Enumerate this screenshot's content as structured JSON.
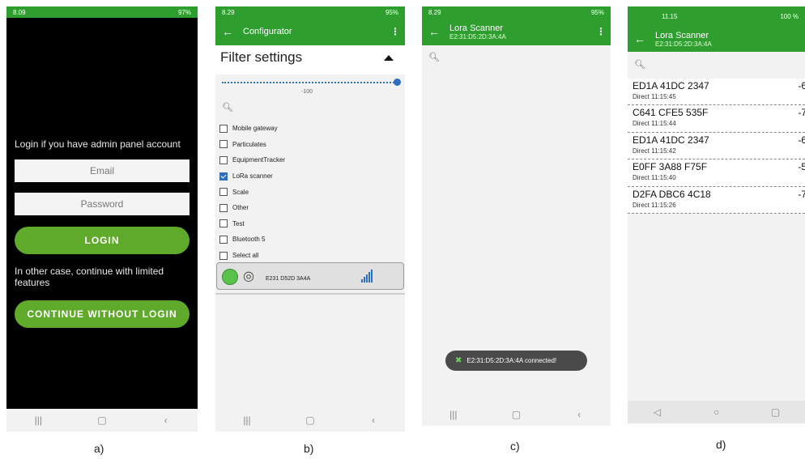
{
  "screen_a": {
    "status": {
      "time": "8.09",
      "right": "97%"
    },
    "login_prompt": "Login if you have admin panel account",
    "email_placeholder": "Email",
    "password_placeholder": "Password",
    "login_button": "LOGIN",
    "other_case_text": "In other case, continue with limited features",
    "continue_button": "CONTINUE WITHOUT LOGIN",
    "caption": "a)"
  },
  "screen_b": {
    "status": {
      "time": "8.29",
      "right": "95%"
    },
    "title": "Configurator",
    "filter_title": "Filter settings",
    "slider_value": "-100",
    "checkboxes": [
      {
        "label": "Mobile gateway",
        "checked": false
      },
      {
        "label": "Particulates",
        "checked": false
      },
      {
        "label": "EquipmentTracker",
        "checked": false
      },
      {
        "label": "LoRa scanner",
        "checked": true
      },
      {
        "label": "Scale",
        "checked": false
      },
      {
        "label": "Other",
        "checked": false
      },
      {
        "label": "Test",
        "checked": false
      },
      {
        "label": "Bluetooth 5",
        "checked": false
      },
      {
        "label": "Select all",
        "checked": false
      }
    ],
    "device_id": "E231 D52D 3A4A",
    "caption": "b)"
  },
  "screen_c": {
    "status": {
      "time": "8.29",
      "right": "95%"
    },
    "title": "Lora Scanner",
    "subtitle": "E2:31:D5:2D:3A:4A",
    "toast": "E2:31:D5:2D:3A:4A connected!",
    "caption": "c)"
  },
  "screen_d": {
    "status": {
      "time": "11.15",
      "right": "100 %"
    },
    "title": "Lora Scanner",
    "subtitle": "E2:31:D5:2D:3A:4A",
    "items": [
      {
        "id": "ED1A 41DC 2347",
        "type": "Direct",
        "time": "11:15:45",
        "rssi": "-6"
      },
      {
        "id": "C641 CFE5 535F",
        "type": "Direct",
        "time": "11:15:44",
        "rssi": "-7"
      },
      {
        "id": "ED1A 41DC 2347",
        "type": "Direct",
        "time": "11:15:42",
        "rssi": "-6"
      },
      {
        "id": "E0FF 3A88 F75F",
        "type": "Direct",
        "time": "11:15:40",
        "rssi": "-5"
      },
      {
        "id": "D2FA DBC6 4C18",
        "type": "Direct",
        "time": "11:15:26",
        "rssi": "-7"
      }
    ],
    "caption": "d)"
  },
  "colors": {
    "app_green": "#2e9e2e",
    "button_green": "#5faa2a",
    "checkbox_blue": "#2c6fbe"
  },
  "icons": [
    "back-arrow-icon",
    "overflow-menu-icon",
    "search-icon",
    "radar-icon",
    "signal-bars-icon",
    "tools-icon",
    "nav-recents-icon",
    "nav-home-icon",
    "nav-back-icon"
  ]
}
